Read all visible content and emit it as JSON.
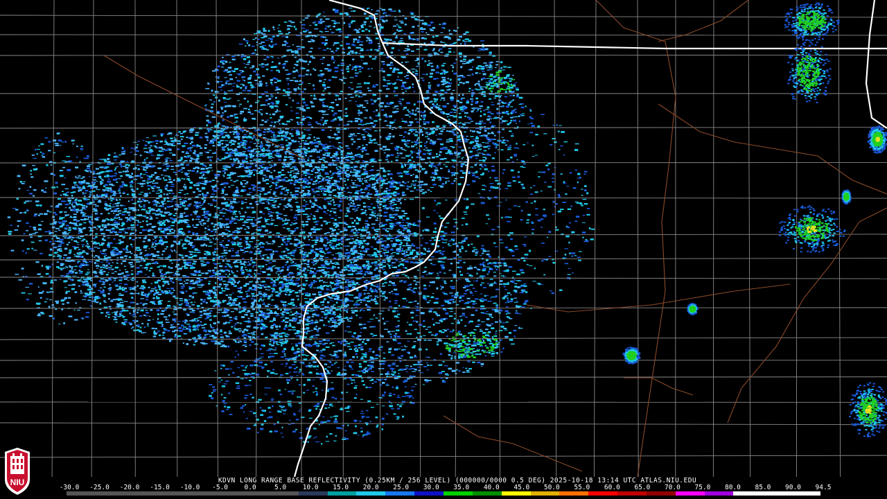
{
  "header": {
    "caption": "KDVN LONG RANGE BASE REFLECTIVITY (0.25KM / 256 LEVEL) (000000/0000 0.5 DEG) 2025-10-18 13:14 UTC  ATLAS.NIU.EDU"
  },
  "legend": {
    "ticks": [
      "-30.0",
      "-25.0",
      "-20.0",
      "-15.0",
      "-10.0",
      "-5.0",
      "0.0",
      "5.0",
      "10.0",
      "15.0",
      "20.0",
      "25.0",
      "30.0",
      "35.0",
      "40.0",
      "45.0",
      "50.0",
      "55.0",
      "60.0",
      "65.0",
      "70.0",
      "75.0",
      "80.0",
      "85.0",
      "90.0",
      "94.5"
    ],
    "colors": [
      "#555555",
      "#555555",
      "#555555",
      "#555555",
      "#555555",
      "#555555",
      "#555555",
      "#555555",
      "#2a3a5a",
      "#00a0a0",
      "#20c8e8",
      "#1878f0",
      "#1010c8",
      "#00d000",
      "#009000",
      "#ffff00",
      "#e0b000",
      "#ff7000",
      "#ff0000",
      "#c00000",
      "#900000",
      "#ff00ff",
      "#a000e0",
      "#ffffff",
      "#ffffff",
      "#ffffff"
    ]
  },
  "logo": {
    "text": "NIU"
  },
  "map": {
    "radar_site": "KDVN",
    "colors": {
      "county_lines": "#8a8a8a",
      "state_lines": "#ffffff",
      "rivers": "#8b4a2a",
      "echo_light": "#4ab8ff",
      "echo_cyan": "#20c8e8",
      "echo_blue": "#1a5ad8",
      "echo_green": "#20d020",
      "echo_yellow": "#e8e020"
    }
  }
}
